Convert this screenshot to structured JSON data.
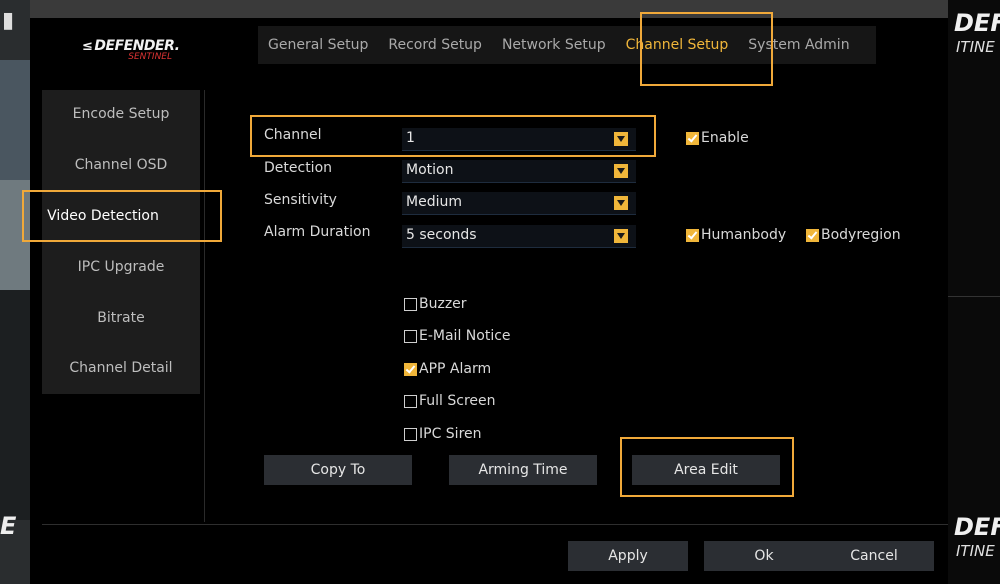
{
  "app": {
    "brand": "DEFENDER.",
    "brand_sub": "SENTINEL",
    "brand_mark": "≤"
  },
  "background": {
    "right_brand": "DEF",
    "right_sub": "ITINE",
    "left_glyph": "E"
  },
  "tabs": [
    {
      "label": "General Setup",
      "active": false
    },
    {
      "label": "Record Setup",
      "active": false
    },
    {
      "label": "Network Setup",
      "active": false
    },
    {
      "label": "Channel Setup",
      "active": true
    },
    {
      "label": "System Admin",
      "active": false
    }
  ],
  "sidebar": {
    "items": [
      {
        "label": "Encode Setup",
        "active": false
      },
      {
        "label": "Channel OSD",
        "active": false
      },
      {
        "label": "Video Detection",
        "active": true
      },
      {
        "label": "IPC Upgrade",
        "active": false
      },
      {
        "label": "Bitrate",
        "active": false
      },
      {
        "label": "Channel Detail",
        "active": false
      }
    ]
  },
  "form": {
    "channel": {
      "label": "Channel",
      "value": "1"
    },
    "detection": {
      "label": "Detection",
      "value": "Motion"
    },
    "sensitivity": {
      "label": "Sensitivity",
      "value": "Medium"
    },
    "alarm_duration": {
      "label": "Alarm Duration",
      "value": "5 seconds"
    },
    "enable": {
      "label": "Enable",
      "checked": true
    },
    "humanbody": {
      "label": "Humanbody",
      "checked": true
    },
    "bodyregion": {
      "label": "Bodyregion",
      "checked": true
    }
  },
  "actions": {
    "buzzer": {
      "label": "Buzzer",
      "checked": false
    },
    "email_notice": {
      "label": "E-Mail Notice",
      "checked": false
    },
    "app_alarm": {
      "label": "APP Alarm",
      "checked": true
    },
    "full_screen": {
      "label": "Full Screen",
      "checked": false
    },
    "ipc_siren": {
      "label": "IPC Siren",
      "checked": false
    }
  },
  "buttons": {
    "copy_to": "Copy To",
    "arming_time": "Arming Time",
    "area_edit": "Area Edit",
    "apply": "Apply",
    "ok": "Ok",
    "cancel": "Cancel"
  },
  "colors": {
    "accent": "#f0b63a",
    "highlight_box": "#f0a93a",
    "panel_bg": "#000000",
    "sidebar_bg": "#1d1d1d",
    "button_bg": "#2b2e33"
  }
}
